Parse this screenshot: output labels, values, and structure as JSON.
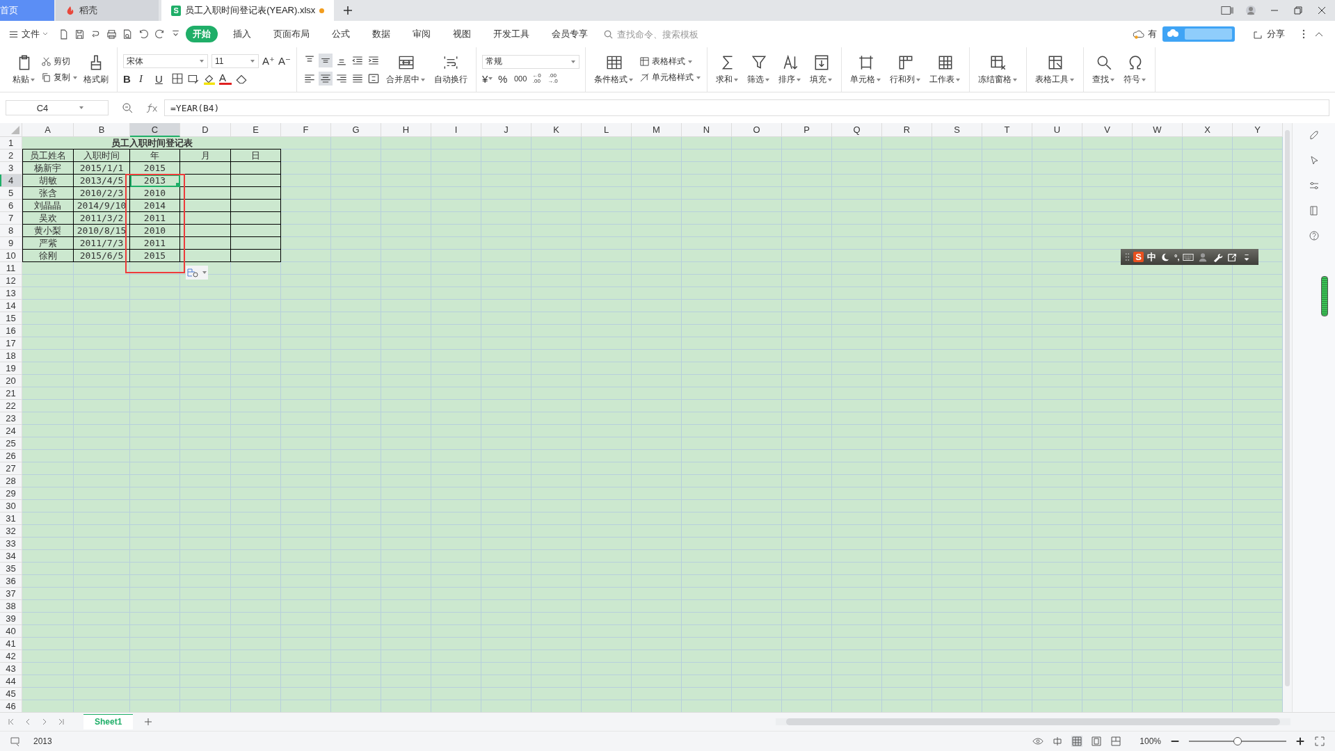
{
  "tabs": [
    {
      "label": "首页",
      "selected": false,
      "kind": "home"
    },
    {
      "label": "稻壳",
      "selected": false,
      "kind": "docer"
    },
    {
      "label": "员工入职时间登记表(YEAR).xlsx",
      "selected": true,
      "kind": "sheet",
      "badge": "S",
      "unsaved": true
    }
  ],
  "menu": {
    "file": "文件",
    "items": [
      {
        "label": "开始",
        "selected": true
      },
      {
        "label": "插入",
        "selected": false
      },
      {
        "label": "页面布局",
        "selected": false
      },
      {
        "label": "公式",
        "selected": false
      },
      {
        "label": "数据",
        "selected": false
      },
      {
        "label": "审阅",
        "selected": false
      },
      {
        "label": "视图",
        "selected": false
      },
      {
        "label": "开发工具",
        "selected": false
      },
      {
        "label": "会员专享",
        "selected": false
      }
    ],
    "search": {
      "placeholder": "查找命令、搜索模板"
    },
    "cloud_partial": "有",
    "share": "分享"
  },
  "ribbon": {
    "clipboard": {
      "paste": "粘贴",
      "cut": "剪切",
      "copy": "复制",
      "format_painter": "格式刷"
    },
    "font": {
      "name": "宋体",
      "size": "11",
      "grow": "A⁺",
      "shrink": "A⁻",
      "bold": "B",
      "italic": "I",
      "underline": "U",
      "font_color": "A"
    },
    "align": {
      "merge": "合并居中",
      "wrap": "自动换行"
    },
    "number": {
      "format": "常规",
      "currency": "¥",
      "percent": "%",
      "thousands": "000",
      "add_decimal": [
        "←0",
        ".00"
      ],
      "remove_decimal": [
        ".00",
        "→.0"
      ]
    },
    "styles": {
      "conditional": "条件格式",
      "table_style": "表格样式",
      "cell_style": "单元格样式"
    },
    "button_groups": [
      [
        {
          "label": "求和"
        },
        {
          "label": "筛选"
        },
        {
          "label": "排序"
        },
        {
          "label": "填充"
        }
      ],
      [
        {
          "label": "单元格"
        },
        {
          "label": "行和列"
        },
        {
          "label": "工作表"
        }
      ],
      [
        {
          "label": "冻结窗格"
        }
      ],
      [
        {
          "label": "表格工具"
        }
      ],
      [
        {
          "label": "查找"
        },
        {
          "label": "符号"
        }
      ]
    ]
  },
  "sheet": {
    "name_box": "C4",
    "formula": "=YEAR(B4)",
    "columns": [
      {
        "label": "A",
        "selected": false
      },
      {
        "label": "B",
        "selected": false
      },
      {
        "label": "C",
        "selected": true
      },
      {
        "label": "D",
        "selected": false
      },
      {
        "label": "E",
        "selected": false
      },
      {
        "label": "F",
        "selected": false
      },
      {
        "label": "G",
        "selected": false
      },
      {
        "label": "H",
        "selected": false
      },
      {
        "label": "I",
        "selected": false
      },
      {
        "label": "J",
        "selected": false
      },
      {
        "label": "K",
        "selected": false
      },
      {
        "label": "L",
        "selected": false
      },
      {
        "label": "M",
        "selected": false
      },
      {
        "label": "N",
        "selected": false
      },
      {
        "label": "O",
        "selected": false
      },
      {
        "label": "P",
        "selected": false
      },
      {
        "label": "Q",
        "selected": false
      },
      {
        "label": "R",
        "selected": false
      },
      {
        "label": "S",
        "selected": false
      },
      {
        "label": "T",
        "selected": false
      },
      {
        "label": "U",
        "selected": false
      },
      {
        "label": "V",
        "selected": false
      },
      {
        "label": "W",
        "selected": false
      },
      {
        "label": "X",
        "selected": false
      },
      {
        "label": "Y",
        "selected": false
      }
    ],
    "rows": [
      {
        "label": "1",
        "selected": false
      },
      {
        "label": "2",
        "selected": false
      },
      {
        "label": "3",
        "selected": false
      },
      {
        "label": "4",
        "selected": true
      },
      {
        "label": "5",
        "selected": false
      },
      {
        "label": "6",
        "selected": false
      },
      {
        "label": "7",
        "selected": false
      },
      {
        "label": "8",
        "selected": false
      },
      {
        "label": "9",
        "selected": false
      },
      {
        "label": "10",
        "selected": false
      },
      {
        "label": "11",
        "selected": false
      },
      {
        "label": "12",
        "selected": false
      },
      {
        "label": "13",
        "selected": false
      },
      {
        "label": "14",
        "selected": false
      },
      {
        "label": "15",
        "selected": false
      },
      {
        "label": "16",
        "selected": false
      },
      {
        "label": "17",
        "selected": false
      },
      {
        "label": "18",
        "selected": false
      },
      {
        "label": "19",
        "selected": false
      },
      {
        "label": "20",
        "selected": false
      },
      {
        "label": "21",
        "selected": false
      },
      {
        "label": "22",
        "selected": false
      },
      {
        "label": "23",
        "selected": false
      },
      {
        "label": "24",
        "selected": false
      },
      {
        "label": "25",
        "selected": false
      },
      {
        "label": "26",
        "selected": false
      },
      {
        "label": "27",
        "selected": false
      },
      {
        "label": "28",
        "selected": false
      },
      {
        "label": "29",
        "selected": false
      },
      {
        "label": "30",
        "selected": false
      },
      {
        "label": "31",
        "selected": false
      },
      {
        "label": "32",
        "selected": false
      },
      {
        "label": "33",
        "selected": false
      },
      {
        "label": "34",
        "selected": false
      },
      {
        "label": "35",
        "selected": false
      },
      {
        "label": "36",
        "selected": false
      },
      {
        "label": "37",
        "selected": false
      },
      {
        "label": "38",
        "selected": false
      },
      {
        "label": "39",
        "selected": false
      },
      {
        "label": "40",
        "selected": false
      },
      {
        "label": "41",
        "selected": false
      },
      {
        "label": "42",
        "selected": false
      },
      {
        "label": "43",
        "selected": false
      },
      {
        "label": "44",
        "selected": false
      },
      {
        "label": "45",
        "selected": false
      },
      {
        "label": "46",
        "selected": false
      }
    ],
    "title": "员工入职时间登记表",
    "header": [
      "员工姓名",
      "入职时间",
      "年",
      "月",
      "日"
    ],
    "records": [
      [
        {
          "text": "杨新宇",
          "selected": false
        },
        {
          "text": "2015/1/1",
          "selected": false
        },
        {
          "text": "2015",
          "selected": false
        }
      ],
      [
        {
          "text": "胡敏",
          "selected": false
        },
        {
          "text": "2013/4/5",
          "selected": false
        },
        {
          "text": "2013",
          "selected": true
        }
      ],
      [
        {
          "text": "张含",
          "selected": false
        },
        {
          "text": "2010/2/3",
          "selected": false
        },
        {
          "text": "2010",
          "selected": false
        }
      ],
      [
        {
          "text": "刘晶晶",
          "selected": false
        },
        {
          "text": "2014/9/10",
          "selected": false
        },
        {
          "text": "2014",
          "selected": false
        }
      ],
      [
        {
          "text": "吴欢",
          "selected": false
        },
        {
          "text": "2011/3/2",
          "selected": false
        },
        {
          "text": "2011",
          "selected": false
        }
      ],
      [
        {
          "text": "黄小梨",
          "selected": false
        },
        {
          "text": "2010/8/15",
          "selected": false
        },
        {
          "text": "2010",
          "selected": false
        }
      ],
      [
        {
          "text": "严紫",
          "selected": false
        },
        {
          "text": "2011/7/3",
          "selected": false
        },
        {
          "text": "2011",
          "selected": false
        }
      ],
      [
        {
          "text": "徐刚",
          "selected": false
        },
        {
          "text": "2015/6/5",
          "selected": false
        },
        {
          "text": "2015",
          "selected": false
        }
      ]
    ]
  },
  "ime_toolbar": {
    "logo": "S",
    "mode": "中",
    "punctuation": "°,"
  },
  "sheet_tabs": [
    {
      "label": "Sheet1",
      "selected": true
    }
  ],
  "status_bar": {
    "sum": "2013",
    "zoom": "100%",
    "zoom_level": {
      "level": 0.5
    }
  }
}
